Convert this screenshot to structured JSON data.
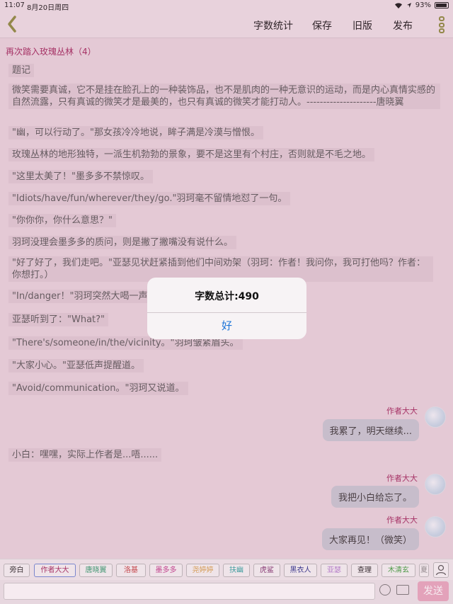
{
  "status_bar": {
    "time": "11:07",
    "date": "8月20日周四",
    "battery": "93%"
  },
  "nav": {
    "items": [
      "字数统计",
      "保存",
      "旧版",
      "发布"
    ]
  },
  "chapter_title": "再次踏入玫瑰丛林（4）",
  "paragraphs": [
    "题记",
    "微笑需要真诚，它不是挂在脸孔上的一种装饰品，也不是肌肉的一种无意识的运动，而是内心真情实感的自然流露，只有真诚的微笑才是最美的，也只有真诚的微笑才能打动人。---------------------唐晓翼",
    "\"幽，可以行动了。\"那女孩冷冷地说，眸子满是冷漠与憎恨。",
    "玫瑰丛林的地形独特，一派生机勃勃的景象，要不是这里有个村庄，否则就是不毛之地。",
    "\"这里太美了！\"墨多多不禁惊叹。",
    "\"Idiots/have/fun/wherever/they/go.\"羽珂毫不留情地怼了一句。",
    "\"你你你，你什么意思？\"",
    "羽珂没理会墨多多的质问，则是撇了撇嘴没有说什么。",
    "\"好了好了，我们走吧。\"亚瑟见状赶紧插到他们中间劝架（羽珂：作者！我问你，我可打他吗？作者：你想打。）",
    "\"In/danger！\"羽珂突然大喝一声",
    "亚瑟听到了：\"What?\"",
    "\"There's/someone/in/the/vicinity。\"羽珂皱紧眉头。",
    "\"大家小心。\"亚瑟低声提醒道。",
    "\"Avoid/communication。\"羽珂又说道。",
    "小白：嘿嘿，实际上作者是...唔......"
  ],
  "messages": [
    {
      "author": "作者大大",
      "text": "我累了，明天继续..."
    },
    {
      "author": "作者大大",
      "text": "我把小白给忘了。"
    },
    {
      "author": "作者大大",
      "text": "大家再见！（微笑）"
    }
  ],
  "alert": {
    "message": "字数总计:490",
    "button": "好"
  },
  "characters": [
    {
      "name": "旁白",
      "color": "#222222"
    },
    {
      "name": "作者大大",
      "color": "#a0245b"
    },
    {
      "name": "唐晓翼",
      "color": "#2a9a6a"
    },
    {
      "name": "洛基",
      "color": "#c43a3a"
    },
    {
      "name": "墨多多",
      "color": "#c23c8c"
    },
    {
      "name": "尧婷婷",
      "color": "#d8a24a"
    },
    {
      "name": "扶幽",
      "color": "#2aa4a0"
    },
    {
      "name": "虎鲨",
      "color": "#7a2a6a"
    },
    {
      "name": "黑衣人",
      "color": "#222a8a"
    },
    {
      "name": "亚瑟",
      "color": "#b07ad0"
    },
    {
      "name": "查理",
      "color": "#222222"
    },
    {
      "name": "木清玄",
      "color": "#3aa03a"
    },
    {
      "name": "夏",
      "color": "#888888"
    }
  ],
  "input": {
    "value": "",
    "send_label": "发送"
  }
}
